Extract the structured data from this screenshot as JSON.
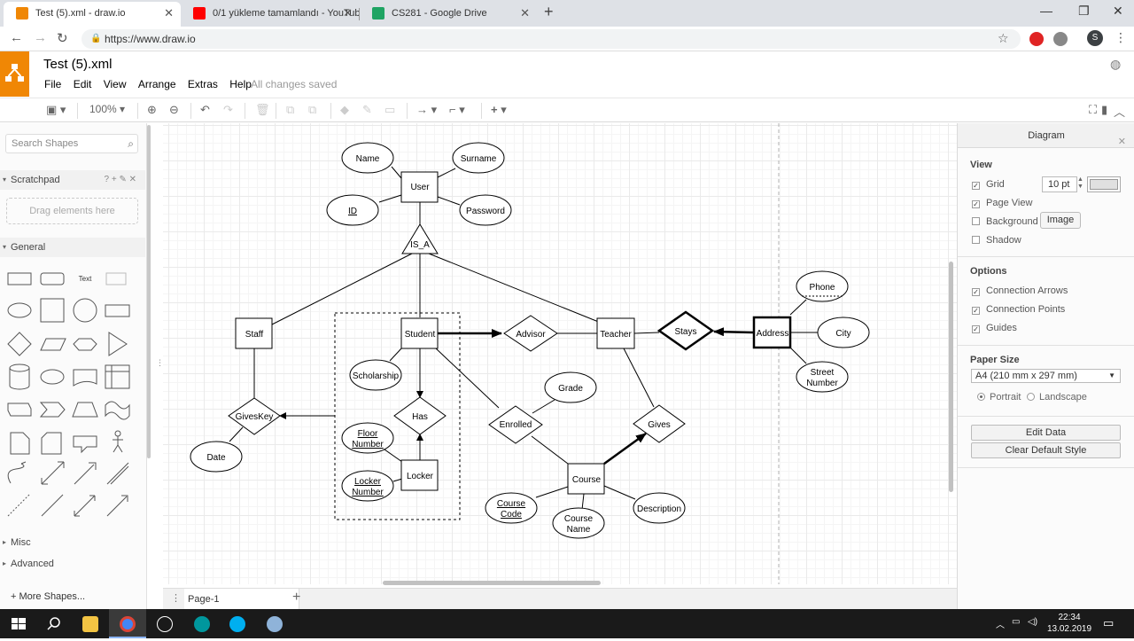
{
  "browser": {
    "tabs": [
      {
        "title": "Test (5).xml - draw.io",
        "favicon_color": "#f08705"
      },
      {
        "title": "0/1 yükleme tamamlandı - YouTube",
        "favicon_color": "#ff0000"
      },
      {
        "title": "CS281 - Google Drive",
        "favicon_color": "#1fa463"
      }
    ],
    "url": "https://www.draw.io",
    "profile_initial": "S"
  },
  "app": {
    "doc_title": "Test (5).xml",
    "menus": [
      "File",
      "Edit",
      "View",
      "Arrange",
      "Extras",
      "Help"
    ],
    "save_status": "All changes saved",
    "accent_color": "#f08705"
  },
  "toolbar": {
    "zoom": "100%"
  },
  "sidebar": {
    "search_placeholder": "Search Shapes",
    "scratchpad_label": "Scratchpad",
    "scratchpad_icons": "? + ✎ ✕",
    "drag_hint": "Drag elements here",
    "general_label": "General",
    "text_shape_label": "Text",
    "misc_label": "Misc",
    "advanced_label": "Advanced",
    "more_shapes": "More Shapes..."
  },
  "diagram": {
    "entities": {
      "user": "User",
      "staff": "Staff",
      "student": "Student",
      "teacher": "Teacher",
      "locker": "Locker",
      "course": "Course",
      "address": "Address"
    },
    "attributes": {
      "name": "Name",
      "surname": "Surname",
      "id": "ID",
      "password": "Password",
      "scholarship": "Scholarship",
      "floor_number_1": "Floor",
      "floor_number_2": "Number",
      "locker_number_1": "Locker",
      "locker_number_2": "Number",
      "date": "Date",
      "grade": "Grade",
      "course_code_1": "Course",
      "course_code_2": "Code",
      "course_name_1": "Course",
      "course_name_2": "Name",
      "description": "Description",
      "phone": "Phone",
      "city": "City",
      "street_number_1": "Street",
      "street_number_2": "Number"
    },
    "relationships": {
      "is_a": "IS_A",
      "has": "Has",
      "giveskey": "GivesKey",
      "advisor": "Advisor",
      "enrolled": "Enrolled",
      "stays": "Stays",
      "gives": "Gives"
    }
  },
  "page_tab": "Page-1",
  "format_panel": {
    "title": "Diagram",
    "view_label": "View",
    "grid_label": "Grid",
    "grid_checked": true,
    "grid_size": "10 pt",
    "page_view_label": "Page View",
    "page_view_checked": true,
    "background_label": "Background",
    "background_checked": false,
    "image_button": "Image",
    "shadow_label": "Shadow",
    "shadow_checked": false,
    "options_label": "Options",
    "connection_arrows_label": "Connection Arrows",
    "connection_points_label": "Connection Points",
    "guides_label": "Guides",
    "paper_size_label": "Paper Size",
    "paper_size_value": "A4 (210 mm x 297 mm)",
    "portrait_label": "Portrait",
    "landscape_label": "Landscape",
    "orientation": "Portrait",
    "edit_data_button": "Edit Data",
    "clear_style_button": "Clear Default Style"
  },
  "taskbar": {
    "time": "22:34",
    "date": "13.02.2019"
  }
}
